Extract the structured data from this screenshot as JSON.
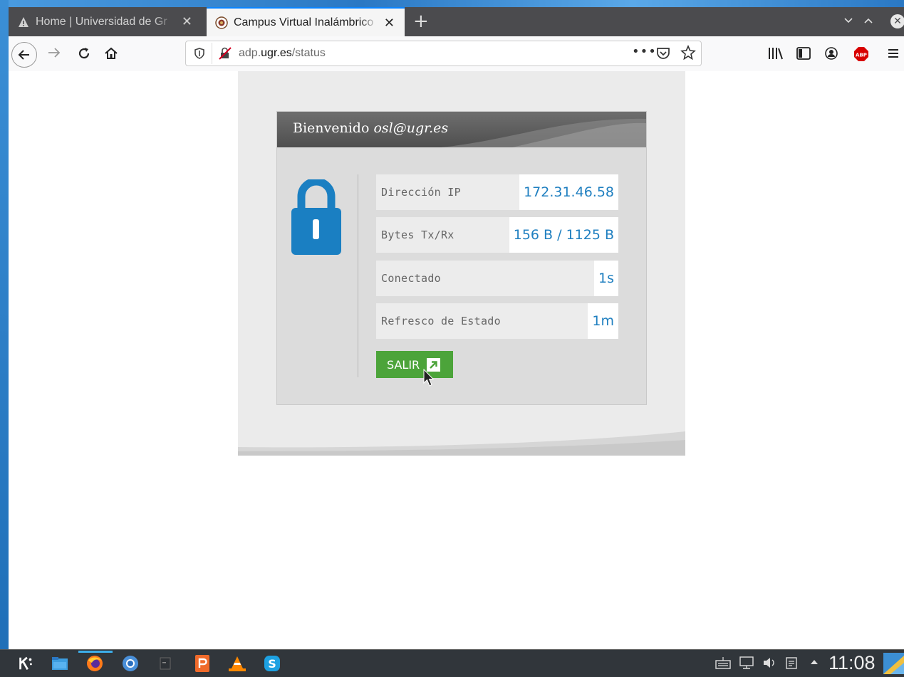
{
  "browser": {
    "tabs": [
      {
        "title": "Home | Universidad de Gr",
        "icon": "warning-icon",
        "active": false
      },
      {
        "title": "Campus Virtual Inalámbrico",
        "icon": "ugr-crest-icon",
        "active": true
      }
    ],
    "url": {
      "host_prefix": "adp.",
      "host_bold": "ugr.es",
      "path": "/status"
    },
    "toolbar_icons": [
      "back-icon",
      "forward-icon",
      "reload-icon",
      "home-icon",
      "shield-icon",
      "insecure-lock-icon",
      "more-icon",
      "pocket-icon",
      "star-icon",
      "library-icon",
      "sidebar-icon",
      "account-icon",
      "adblock-icon",
      "menu-icon"
    ],
    "adblock_label": "ABP"
  },
  "card": {
    "welcome_text": "Bienvenido",
    "user": "osl@ugr.es",
    "rows": [
      {
        "label": "Dirección IP",
        "value": "172.31.46.58"
      },
      {
        "label": "Bytes Tx/Rx",
        "value": "156 B / 1125 B"
      },
      {
        "label": "Conectado",
        "value": "1s"
      },
      {
        "label": "Refresco de Estado",
        "value": "1m"
      }
    ],
    "logout_label": "SALIR",
    "accent": "#1f7fc0",
    "button_color": "#4ca43a"
  },
  "taskbar": {
    "clock": "11:08",
    "apps": [
      "kde-launcher-icon",
      "file-manager-icon",
      "firefox-icon",
      "chromium-icon",
      "terminal-icon",
      "presentation-icon",
      "vlc-icon",
      "skype-icon"
    ]
  }
}
